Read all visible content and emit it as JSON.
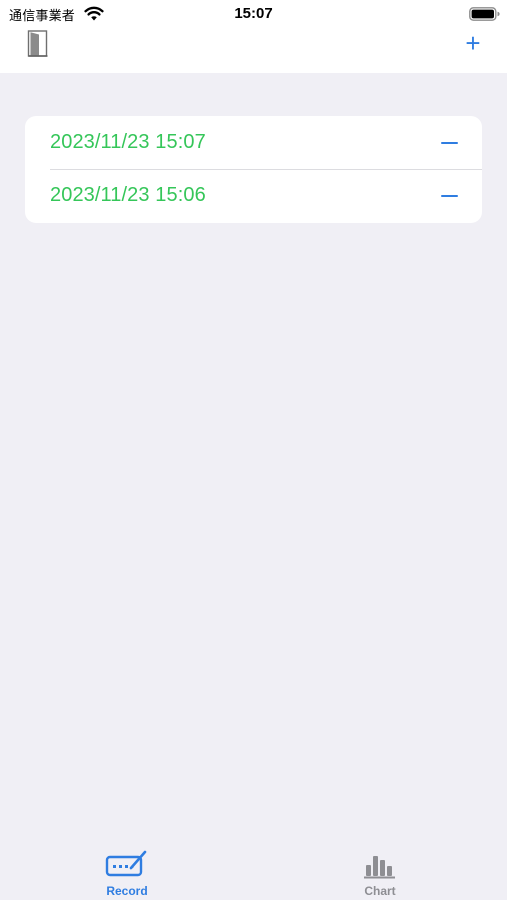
{
  "status_bar": {
    "carrier": "通信事業者",
    "time": "15:07"
  },
  "nav_bar": {
    "left_icon": "door-icon",
    "right_icon": "plus-icon",
    "add_label": "+"
  },
  "records": [
    {
      "datetime": "2023/11/23 15:07"
    },
    {
      "datetime": "2023/11/23 15:06"
    }
  ],
  "tab_bar": {
    "tabs": [
      {
        "label": "Record",
        "icon": "record-pencil-icon",
        "selected": true
      },
      {
        "label": "Chart",
        "icon": "bar-chart-icon",
        "selected": false
      }
    ]
  },
  "colors": {
    "accent": "#2f7de1",
    "record_text": "#35c659",
    "background": "#f0eff5",
    "inactive_tab": "#8e8e93"
  }
}
